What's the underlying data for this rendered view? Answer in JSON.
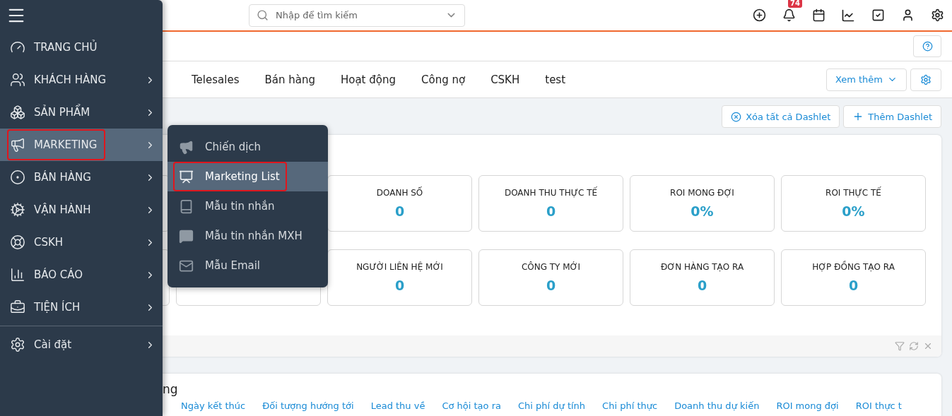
{
  "header": {
    "search": {
      "placeholder": "Nhập để tìm kiếm"
    },
    "notification_count": "74"
  },
  "tabs": [
    {
      "label": "Telesales"
    },
    {
      "label": "Bán hàng"
    },
    {
      "label": "Hoạt động"
    },
    {
      "label": "Công nợ"
    },
    {
      "label": "CSKH"
    },
    {
      "label": "test"
    }
  ],
  "tab_actions": {
    "more": "Xem thêm"
  },
  "dashlet_actions": [
    {
      "kind": "remove",
      "label": "Xóa tất cả Dashlet"
    },
    {
      "kind": "add",
      "label": "Thêm Dashlet"
    }
  ],
  "stats": [
    {
      "label": "DOANH SỐ",
      "value": "0"
    },
    {
      "label": "DOANH THU THỰC TẾ",
      "value": "0"
    },
    {
      "label": "ROI MONG ĐỢI",
      "value": "0%"
    },
    {
      "label": "ROI THỰC TẾ",
      "value": "0%"
    },
    {
      "label": "NGƯỜI LIÊN HỆ MỚI",
      "value": "0"
    },
    {
      "label": "CÔNG TY MỚI",
      "value": "0"
    },
    {
      "label": "ĐƠN HÀNG TẠO RA",
      "value": "0"
    },
    {
      "label": "HỢP ĐỒNG TẠO RA",
      "value": "0"
    }
  ],
  "second_card": {
    "title": "ng",
    "columns": [
      "Ngày kết thúc",
      "Đối tượng hướng tới",
      "Lead thu về",
      "Cơ hội tạo ra",
      "Chi phí dự tính",
      "Chi phí thực",
      "Doanh thu dự kiến",
      "ROI mong đợi",
      "ROI thực t"
    ]
  },
  "sidebar": {
    "items": [
      {
        "label": "TRANG CHỦ",
        "has_children": false,
        "selected": false,
        "outlined": false
      },
      {
        "label": "KHÁCH HÀNG",
        "has_children": true,
        "selected": false,
        "outlined": false
      },
      {
        "label": "SẢN PHẨM",
        "has_children": true,
        "selected": false,
        "outlined": false
      },
      {
        "label": "MARKETING",
        "has_children": true,
        "selected": true,
        "outlined": true
      },
      {
        "label": "BÁN HÀNG",
        "has_children": true,
        "selected": false,
        "outlined": false
      },
      {
        "label": "VẬN HÀNH",
        "has_children": true,
        "selected": false,
        "outlined": false
      },
      {
        "label": "CSKH",
        "has_children": true,
        "selected": false,
        "outlined": false
      },
      {
        "label": "BÁO CÁO",
        "has_children": true,
        "selected": false,
        "outlined": false
      },
      {
        "label": "TIỆN ÍCH",
        "has_children": true,
        "selected": false,
        "outlined": false
      }
    ],
    "footer_item": {
      "label": "Cài đặt",
      "has_children": true
    }
  },
  "submenu": [
    {
      "label": "Chiến dịch",
      "selected": false,
      "outlined": false
    },
    {
      "label": "Marketing List",
      "selected": true,
      "outlined": true
    },
    {
      "label": "Mẫu tin nhắn",
      "selected": false,
      "outlined": false
    },
    {
      "label": "Mẫu tin nhắn MXH",
      "selected": false,
      "outlined": false
    },
    {
      "label": "Mẫu Email",
      "selected": false,
      "outlined": false
    }
  ]
}
